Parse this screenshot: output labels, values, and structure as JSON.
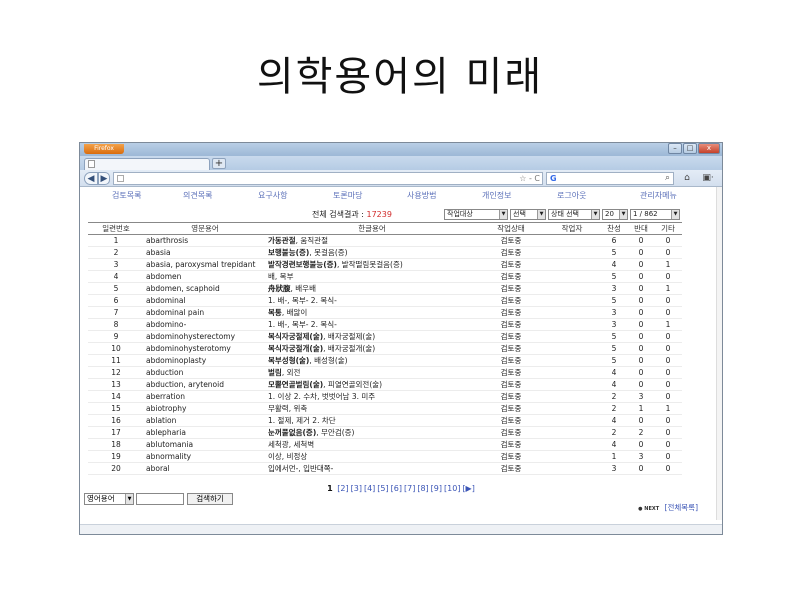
{
  "slide": {
    "title": "의학용어의 미래"
  },
  "browser": {
    "firefox_label": "Firefox",
    "new_tab": "+",
    "back": "◀",
    "forward": "▶",
    "url_controls": "☆ - C",
    "search_engine": "G",
    "search_icon": "⌕",
    "home_icon": "⌂",
    "menu_icon": "▣·",
    "win_min": "–",
    "win_max": "□",
    "win_close": "x"
  },
  "nav_menu": [
    "검토목록",
    "의견목록",
    "요구사항",
    "토론마당",
    "사용방법",
    "개인정보",
    "로그아웃",
    "관리자메뉴"
  ],
  "result_bar": {
    "label": "전체 검색결과 : ",
    "count": "17239",
    "filter_select": "작업대상",
    "select2": "선택",
    "status_select": "상태 선택",
    "page_size": "20",
    "page_indicator": "1 / 862"
  },
  "table": {
    "headers": [
      "일련번호",
      "영문용어",
      "한글용어",
      "작업상태",
      "작업자",
      "찬성",
      "반대",
      "기타"
    ],
    "rows": [
      {
        "no": "1",
        "en": "abarthrosis",
        "ko_bold": "가동관절",
        "ko_rest": ", 움직관절",
        "status": "검토중",
        "worker": "",
        "agree": "6",
        "disagree": "0",
        "etc": "0"
      },
      {
        "no": "2",
        "en": "abasia",
        "ko_bold": "보행불능(증)",
        "ko_rest": ", 못걸음(증)",
        "status": "검토중",
        "worker": "",
        "agree": "5",
        "disagree": "0",
        "etc": "0"
      },
      {
        "no": "3",
        "en": "abasia, paroxysmal trepidant",
        "ko_bold": "발작경련보행불능(증)",
        "ko_rest": ", 발작떨림못걸음(증)",
        "status": "검토중",
        "worker": "",
        "agree": "4",
        "disagree": "0",
        "etc": "1"
      },
      {
        "no": "4",
        "en": "abdomen",
        "ko_bold": "",
        "ko_rest": "배, 복부",
        "status": "검토중",
        "worker": "",
        "agree": "5",
        "disagree": "0",
        "etc": "0"
      },
      {
        "no": "5",
        "en": "abdomen, scaphoid",
        "ko_bold": "舟狀腹",
        "ko_rest": ", 배우배",
        "status": "검토중",
        "worker": "",
        "agree": "3",
        "disagree": "0",
        "etc": "1"
      },
      {
        "no": "6",
        "en": "abdominal",
        "ko_bold": "",
        "ko_rest": "1. 배-, 복부- 2. 복식-",
        "status": "검토중",
        "worker": "",
        "agree": "5",
        "disagree": "0",
        "etc": "0"
      },
      {
        "no": "7",
        "en": "abdominal pain",
        "ko_bold": "복통",
        "ko_rest": ", 배앓이",
        "status": "검토중",
        "worker": "",
        "agree": "3",
        "disagree": "0",
        "etc": "0"
      },
      {
        "no": "8",
        "en": "abdomino-",
        "ko_bold": "",
        "ko_rest": "1. 배-, 복부- 2. 복식-",
        "status": "검토중",
        "worker": "",
        "agree": "3",
        "disagree": "0",
        "etc": "1"
      },
      {
        "no": "9",
        "en": "abdominohysterectomy",
        "ko_bold": "복식자궁절제(술)",
        "ko_rest": ", 배자궁절제(술)",
        "status": "검토중",
        "worker": "",
        "agree": "5",
        "disagree": "0",
        "etc": "0"
      },
      {
        "no": "10",
        "en": "abdominohysterotomy",
        "ko_bold": "복식자궁절개(술)",
        "ko_rest": ", 배자궁절개(술)",
        "status": "검토중",
        "worker": "",
        "agree": "5",
        "disagree": "0",
        "etc": "0"
      },
      {
        "no": "11",
        "en": "abdominoplasty",
        "ko_bold": "복부성형(술)",
        "ko_rest": ", 배성형(술)",
        "status": "검토중",
        "worker": "",
        "agree": "5",
        "disagree": "0",
        "etc": "0"
      },
      {
        "no": "12",
        "en": "abduction",
        "ko_bold": "벌림",
        "ko_rest": ", 외전",
        "status": "검토중",
        "worker": "",
        "agree": "4",
        "disagree": "0",
        "etc": "0"
      },
      {
        "no": "13",
        "en": "abduction, arytenoid",
        "ko_bold": "모뿔연골벌림(술)",
        "ko_rest": ", 피열연골외전(술)",
        "status": "검토중",
        "worker": "",
        "agree": "4",
        "disagree": "0",
        "etc": "0"
      },
      {
        "no": "14",
        "en": "aberration",
        "ko_bold": "",
        "ko_rest": "1. 이상 2. 수차, 벗벗어남 3. 미주",
        "status": "검토중",
        "worker": "",
        "agree": "2",
        "disagree": "3",
        "etc": "0"
      },
      {
        "no": "15",
        "en": "abiotrophy",
        "ko_bold": "",
        "ko_rest": "무활력, 위축",
        "status": "검토중",
        "worker": "",
        "agree": "2",
        "disagree": "1",
        "etc": "1"
      },
      {
        "no": "16",
        "en": "ablation",
        "ko_bold": "",
        "ko_rest": "1. 절제, 제거 2. 차단",
        "status": "검토중",
        "worker": "",
        "agree": "4",
        "disagree": "0",
        "etc": "0"
      },
      {
        "no": "17",
        "en": "ablepharia",
        "ko_bold": "눈꺼풀없음(증)",
        "ko_rest": ", 무안검(증)",
        "status": "검토중",
        "worker": "",
        "agree": "2",
        "disagree": "2",
        "etc": "0"
      },
      {
        "no": "18",
        "en": "ablutomania",
        "ko_bold": "",
        "ko_rest": "세척광, 세척벽",
        "status": "검토중",
        "worker": "",
        "agree": "4",
        "disagree": "0",
        "etc": "0"
      },
      {
        "no": "19",
        "en": "abnormality",
        "ko_bold": "",
        "ko_rest": "이상, 비정상",
        "status": "검토중",
        "worker": "",
        "agree": "1",
        "disagree": "3",
        "etc": "0"
      },
      {
        "no": "20",
        "en": "aboral",
        "ko_bold": "",
        "ko_rest": "입에서먼-, 입반대쪽-",
        "status": "검토중",
        "worker": "",
        "agree": "3",
        "disagree": "0",
        "etc": "0"
      }
    ]
  },
  "pager": {
    "current": "1",
    "pages": [
      "[2]",
      "[3]",
      "[4]",
      "[5]",
      "[6]",
      "[7]",
      "[8]",
      "[9]",
      "[10]",
      "[▶]"
    ]
  },
  "search_form": {
    "language": "영어용어",
    "term_value": "",
    "button": "검색하기"
  },
  "footer": {
    "next_label": "● NEXT",
    "full_list": "[전체목록]"
  }
}
